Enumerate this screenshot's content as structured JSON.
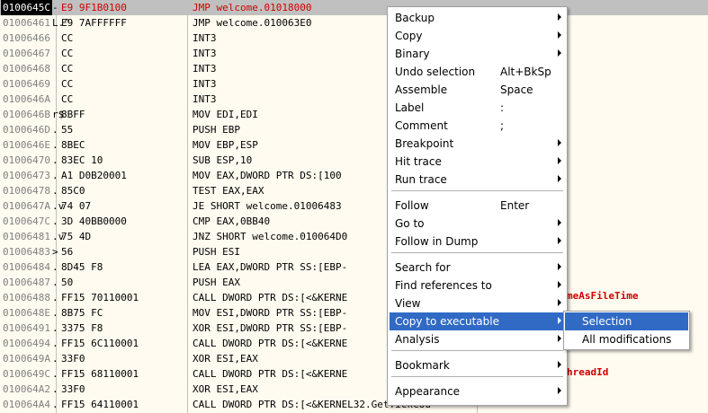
{
  "disasm": {
    "rows": [
      {
        "addr": "0100645C",
        "mark": "-",
        "hex": "E9 9F1B0100",
        "asm": "JMP welcome.01018000",
        "sel": true,
        "red": true
      },
      {
        "addr": "01006461",
        "mark": "L.^",
        "hex": "E9 7AFFFFFF",
        "asm": "JMP welcome.010063E0"
      },
      {
        "addr": "01006466",
        "mark": "",
        "hex": "CC",
        "asm": "INT3"
      },
      {
        "addr": "01006467",
        "mark": "",
        "hex": "CC",
        "asm": "INT3"
      },
      {
        "addr": "01006468",
        "mark": "",
        "hex": "CC",
        "asm": "INT3"
      },
      {
        "addr": "01006469",
        "mark": "",
        "hex": "CC",
        "asm": "INT3"
      },
      {
        "addr": "0100646A",
        "mark": "",
        "hex": "CC",
        "asm": "INT3"
      },
      {
        "addr": "0100646B",
        "mark": "r$",
        "hex": "8BFF",
        "asm": "MOV EDI,EDI"
      },
      {
        "addr": "0100646D",
        "mark": ".",
        "hex": "55",
        "asm": "PUSH EBP"
      },
      {
        "addr": "0100646E",
        "mark": ".",
        "hex": "8BEC",
        "asm": "MOV EBP,ESP"
      },
      {
        "addr": "01006470",
        "mark": ".",
        "hex": "83EC 10",
        "asm": "SUB ESP,10"
      },
      {
        "addr": "01006473",
        "mark": ".",
        "hex": "A1 D0B20001",
        "asm": "MOV EAX,DWORD PTR DS:[100"
      },
      {
        "addr": "01006478",
        "mark": ".",
        "hex": "85C0",
        "asm": "TEST EAX,EAX"
      },
      {
        "addr": "0100647A",
        "mark": ".v",
        "hex": "74 07",
        "asm": "JE SHORT welcome.01006483"
      },
      {
        "addr": "0100647C",
        "mark": ".",
        "hex": "3D 40BB0000",
        "asm": "CMP EAX,0BB40"
      },
      {
        "addr": "01006481",
        "mark": ".v",
        "hex": "75 4D",
        "asm": "JNZ SHORT welcome.010064D0"
      },
      {
        "addr": "01006483",
        "mark": ">",
        "hex": "56",
        "asm": "PUSH ESI"
      },
      {
        "addr": "01006484",
        "mark": ".",
        "hex": "8D45 F8",
        "asm": "LEA EAX,DWORD PTR SS:[EBP-"
      },
      {
        "addr": "01006487",
        "mark": ".",
        "hex": "50",
        "asm": "PUSH EAX"
      },
      {
        "addr": "01006488",
        "mark": ".",
        "hex": "FF15 70110001",
        "asm": "CALL DWORD PTR DS:[<&KERNE"
      },
      {
        "addr": "0100648E",
        "mark": ".",
        "hex": "8B75 FC",
        "asm": "MOV ESI,DWORD PTR SS:[EBP-"
      },
      {
        "addr": "01006491",
        "mark": ".",
        "hex": "3375 F8",
        "asm": "XOR ESI,DWORD PTR SS:[EBP-"
      },
      {
        "addr": "01006494",
        "mark": ".",
        "hex": "FF15 6C110001",
        "asm": "CALL DWORD PTR DS:[<&KERNE"
      },
      {
        "addr": "0100649A",
        "mark": ".",
        "hex": "33F0",
        "asm": "XOR ESI,EAX"
      },
      {
        "addr": "0100649C",
        "mark": ".",
        "hex": "FF15 68110001",
        "asm": "CALL DWORD PTR DS:[<&KERNE"
      },
      {
        "addr": "010064A2",
        "mark": ".",
        "hex": "33F0",
        "asm": "XOR ESI,EAX"
      },
      {
        "addr": "010064A4",
        "mark": ".",
        "hex": "FF15 64110001",
        "asm": "CALL DWORD PTR DS:[<&KERNEL32.GetTickCou"
      }
    ],
    "comments": {
      "c1": "meAsFileTime",
      "c2": "hreadId",
      "c3": "GetTickCount"
    }
  },
  "context_menu": {
    "items": [
      {
        "label": "Backup",
        "shortcut": "",
        "sub": true
      },
      {
        "label": "Copy",
        "shortcut": "",
        "sub": true
      },
      {
        "label": "Binary",
        "shortcut": "",
        "sub": true
      },
      {
        "label": "Undo selection",
        "shortcut": "Alt+BkSp",
        "sub": false
      },
      {
        "label": "Assemble",
        "shortcut": "Space",
        "sub": false
      },
      {
        "label": "Label",
        "shortcut": ":",
        "sub": false
      },
      {
        "label": "Comment",
        "shortcut": ";",
        "sub": false
      },
      {
        "label": "Breakpoint",
        "shortcut": "",
        "sub": true
      },
      {
        "label": "Hit trace",
        "shortcut": "",
        "sub": true
      },
      {
        "label": "Run trace",
        "shortcut": "",
        "sub": true
      },
      {
        "label": "Follow",
        "shortcut": "Enter",
        "sub": false
      },
      {
        "label": "Go to",
        "shortcut": "",
        "sub": true
      },
      {
        "label": "Follow in Dump",
        "shortcut": "",
        "sub": true
      },
      {
        "label": "Search for",
        "shortcut": "",
        "sub": true
      },
      {
        "label": "Find references to",
        "shortcut": "",
        "sub": true
      },
      {
        "label": "View",
        "shortcut": "",
        "sub": true
      },
      {
        "label": "Copy to executable",
        "shortcut": "",
        "sub": true,
        "highlight": true
      },
      {
        "label": "Analysis",
        "shortcut": "",
        "sub": true
      },
      {
        "label": "Bookmark",
        "shortcut": "",
        "sub": true
      },
      {
        "label": "Appearance",
        "shortcut": "",
        "sub": true
      }
    ]
  },
  "submenu": {
    "items": [
      {
        "label": "Selection",
        "highlight": true
      },
      {
        "label": "All modifications"
      }
    ]
  },
  "colors": {
    "highlight": "#316ac5",
    "red_text": "#d00000",
    "background": "#fffbf0"
  }
}
